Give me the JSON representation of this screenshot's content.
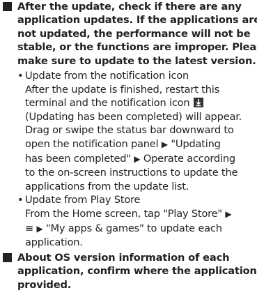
{
  "sections": [
    {
      "marker": "square",
      "lines": [
        "After the update, check if there are any",
        "application updates. If the applications are",
        "not updated, the performance will not be",
        "stable, or the functions are improper. Please",
        "make sure to update to the latest version."
      ]
    },
    {
      "marker": "square",
      "lines": [
        "About OS version information of each",
        "application, confirm where the application is",
        "provided."
      ]
    }
  ],
  "bullets": [
    {
      "marker": "•",
      "lines": [
        "Update from the notification icon",
        "After the update is finished, restart this",
        "terminal and the notification icon",
        "(Updating has been completed) will appear.",
        "Drag or swipe the status bar downward to",
        "open the notification panel",
        "\"Updating",
        "has been completed\"",
        "Operate according",
        "to the on-screen instructions to update the",
        "applications from the update list."
      ],
      "inline_icon": "update-notification-icon",
      "arrow_glyph": "▶"
    },
    {
      "marker": "•",
      "lines": [
        "Update from Play Store",
        "From the Home screen, tap \"Play Store\"",
        "≡",
        "\"My apps & games\" to update each",
        "application."
      ],
      "arrow_glyph": "▶"
    }
  ]
}
